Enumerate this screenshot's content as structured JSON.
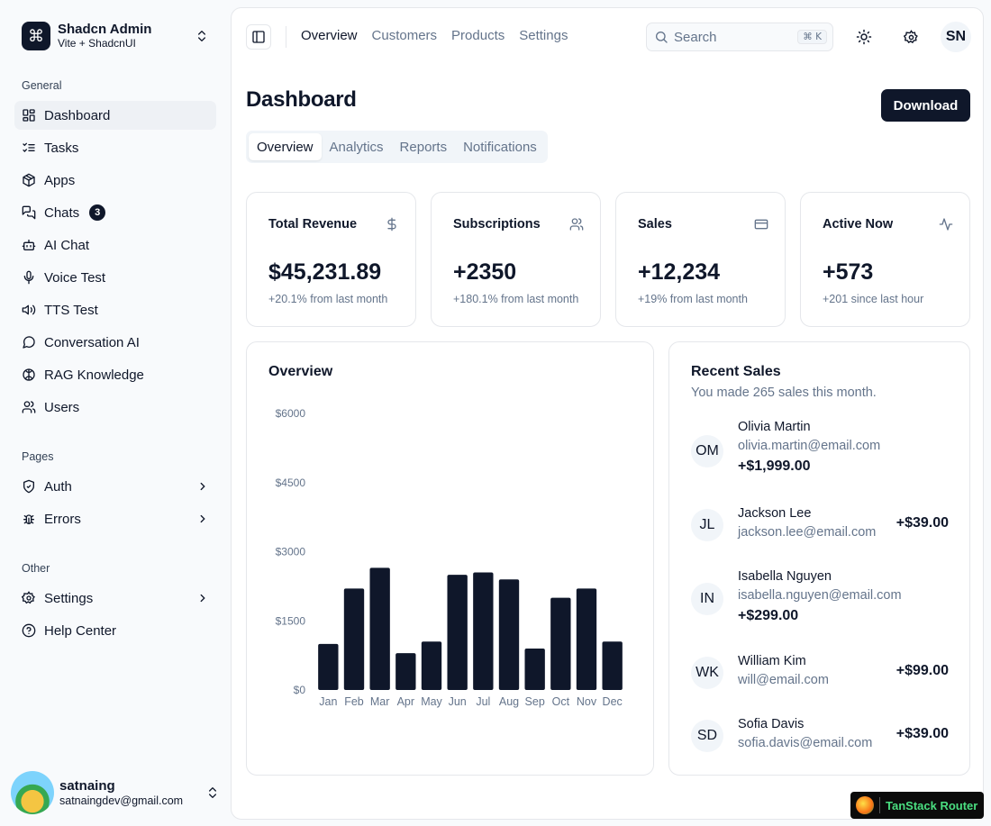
{
  "brand": {
    "title": "Shadcn Admin",
    "subtitle": "Vite + ShadcnUI",
    "logo_glyph": "⌘"
  },
  "sidebar": {
    "groups": [
      {
        "label": "General"
      },
      {
        "label": "Pages"
      },
      {
        "label": "Other"
      }
    ],
    "items": [
      {
        "label": "Dashboard",
        "icon": "layout-dashboard-icon"
      },
      {
        "label": "Tasks",
        "icon": "list-checks-icon"
      },
      {
        "label": "Apps",
        "icon": "package-icon"
      },
      {
        "label": "Chats",
        "icon": "messages-icon",
        "badge": "3"
      },
      {
        "label": "AI Chat",
        "icon": "bot-icon"
      },
      {
        "label": "Voice Test",
        "icon": "mic-icon"
      },
      {
        "label": "TTS Test",
        "icon": "volume-icon"
      },
      {
        "label": "Conversation AI",
        "icon": "message-circle-icon"
      },
      {
        "label": "RAG Knowledge",
        "icon": "brain-icon"
      },
      {
        "label": "Users",
        "icon": "users-icon"
      },
      {
        "label": "Auth",
        "icon": "shield-check-icon"
      },
      {
        "label": "Errors",
        "icon": "bug-icon"
      },
      {
        "label": "Settings",
        "icon": "gear-icon"
      },
      {
        "label": "Help Center",
        "icon": "help-circle-icon"
      }
    ]
  },
  "user": {
    "name": "satnaing",
    "email": "satnaingdev@gmail.com"
  },
  "topnav": {
    "links": [
      "Overview",
      "Customers",
      "Products",
      "Settings"
    ]
  },
  "search": {
    "placeholder": "Search",
    "shortcut": "⌘ K"
  },
  "profile_initials": "SN",
  "page": {
    "title": "Dashboard",
    "download_label": "Download"
  },
  "tabs": [
    "Overview",
    "Analytics",
    "Reports",
    "Notifications"
  ],
  "stats": [
    {
      "title": "Total Revenue",
      "value": "$45,231.89",
      "sub": "+20.1% from last month",
      "icon": "dollar-icon"
    },
    {
      "title": "Subscriptions",
      "value": "+2350",
      "sub": "+180.1% from last month",
      "icon": "users-icon"
    },
    {
      "title": "Sales",
      "value": "+12,234",
      "sub": "+19% from last month",
      "icon": "credit-card-icon"
    },
    {
      "title": "Active Now",
      "value": "+573",
      "sub": "+201 since last hour",
      "icon": "activity-icon"
    }
  ],
  "overview": {
    "title": "Overview"
  },
  "chart_data": {
    "type": "bar",
    "title": "Overview",
    "categories": [
      "Jan",
      "Feb",
      "Mar",
      "Apr",
      "May",
      "Jun",
      "Jul",
      "Aug",
      "Sep",
      "Oct",
      "Nov",
      "Dec"
    ],
    "values": [
      1000,
      2200,
      2650,
      800,
      1050,
      2500,
      2550,
      2400,
      900,
      2000,
      2200,
      1050
    ],
    "yticks": [
      "$0",
      "$1500",
      "$3000",
      "$4500",
      "$6000"
    ],
    "ylim": [
      0,
      6000
    ],
    "bar_color": "#0f172a",
    "grid": false
  },
  "recent_sales": {
    "title": "Recent Sales",
    "description": "You made 265 sales this month.",
    "items": [
      {
        "initials": "OM",
        "name": "Olivia Martin",
        "email": "olivia.martin@email.com",
        "amount": "+$1,999.00"
      },
      {
        "initials": "JL",
        "name": "Jackson Lee",
        "email": "jackson.lee@email.com",
        "amount": "+$39.00"
      },
      {
        "initials": "IN",
        "name": "Isabella Nguyen",
        "email": "isabella.nguyen@email.com",
        "amount": "+$299.00"
      },
      {
        "initials": "WK",
        "name": "William Kim",
        "email": "will@email.com",
        "amount": "+$99.00"
      },
      {
        "initials": "SD",
        "name": "Sofia Davis",
        "email": "sofia.davis@email.com",
        "amount": "+$39.00"
      }
    ]
  },
  "router_badge": {
    "label": "TanStack Router"
  },
  "colors": {
    "primary": "#0f172a",
    "muted": "#64748b",
    "border": "#e5e7eb",
    "surface": "#f8fafc"
  }
}
